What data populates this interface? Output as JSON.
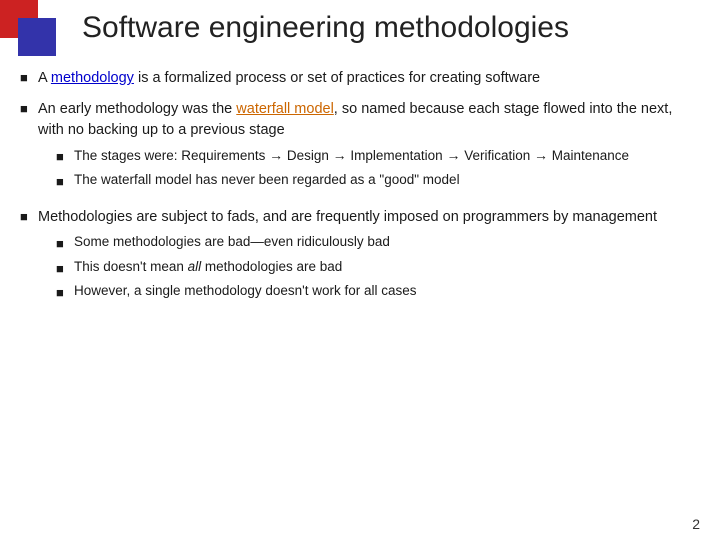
{
  "slide": {
    "title": "Software engineering methodologies",
    "page_number": "2",
    "decoration": {
      "square_red_color": "#cc2222",
      "square_blue_color": "#3333aa"
    },
    "bullets": [
      {
        "id": "bullet1",
        "text_parts": [
          {
            "text": "A ",
            "style": "normal"
          },
          {
            "text": "methodology",
            "style": "link-blue"
          },
          {
            "text": " is a formalized process or set of practices for creating software",
            "style": "normal"
          }
        ],
        "sub_bullets": []
      },
      {
        "id": "bullet2",
        "text_parts": [
          {
            "text": "An early methodology was the ",
            "style": "normal"
          },
          {
            "text": "waterfall model",
            "style": "link-orange"
          },
          {
            "text": ", so named because each stage flowed into the next, with no backing up to a previous stage",
            "style": "normal"
          }
        ],
        "sub_bullets": [
          {
            "id": "sub1",
            "text": "The stages were: Requirements → Design → Implementation → Verification → Maintenance"
          },
          {
            "id": "sub2",
            "text": "The waterfall model has never been regarded as a “good” model"
          }
        ]
      },
      {
        "id": "bullet3",
        "text_parts": [
          {
            "text": "Methodologies are subject to fads, and are frequently imposed on programmers by management",
            "style": "normal"
          }
        ],
        "sub_bullets": [
          {
            "id": "sub3",
            "text": "Some methodologies are bad—even ridiculously bad"
          },
          {
            "id": "sub4",
            "text_parts": [
              {
                "text": "This doesn’t mean ",
                "style": "normal"
              },
              {
                "text": "all",
                "style": "italic"
              },
              {
                "text": " methodologies are bad",
                "style": "normal"
              }
            ]
          },
          {
            "id": "sub5",
            "text": "However, a single methodology doesn’t work for all cases"
          }
        ]
      }
    ]
  }
}
